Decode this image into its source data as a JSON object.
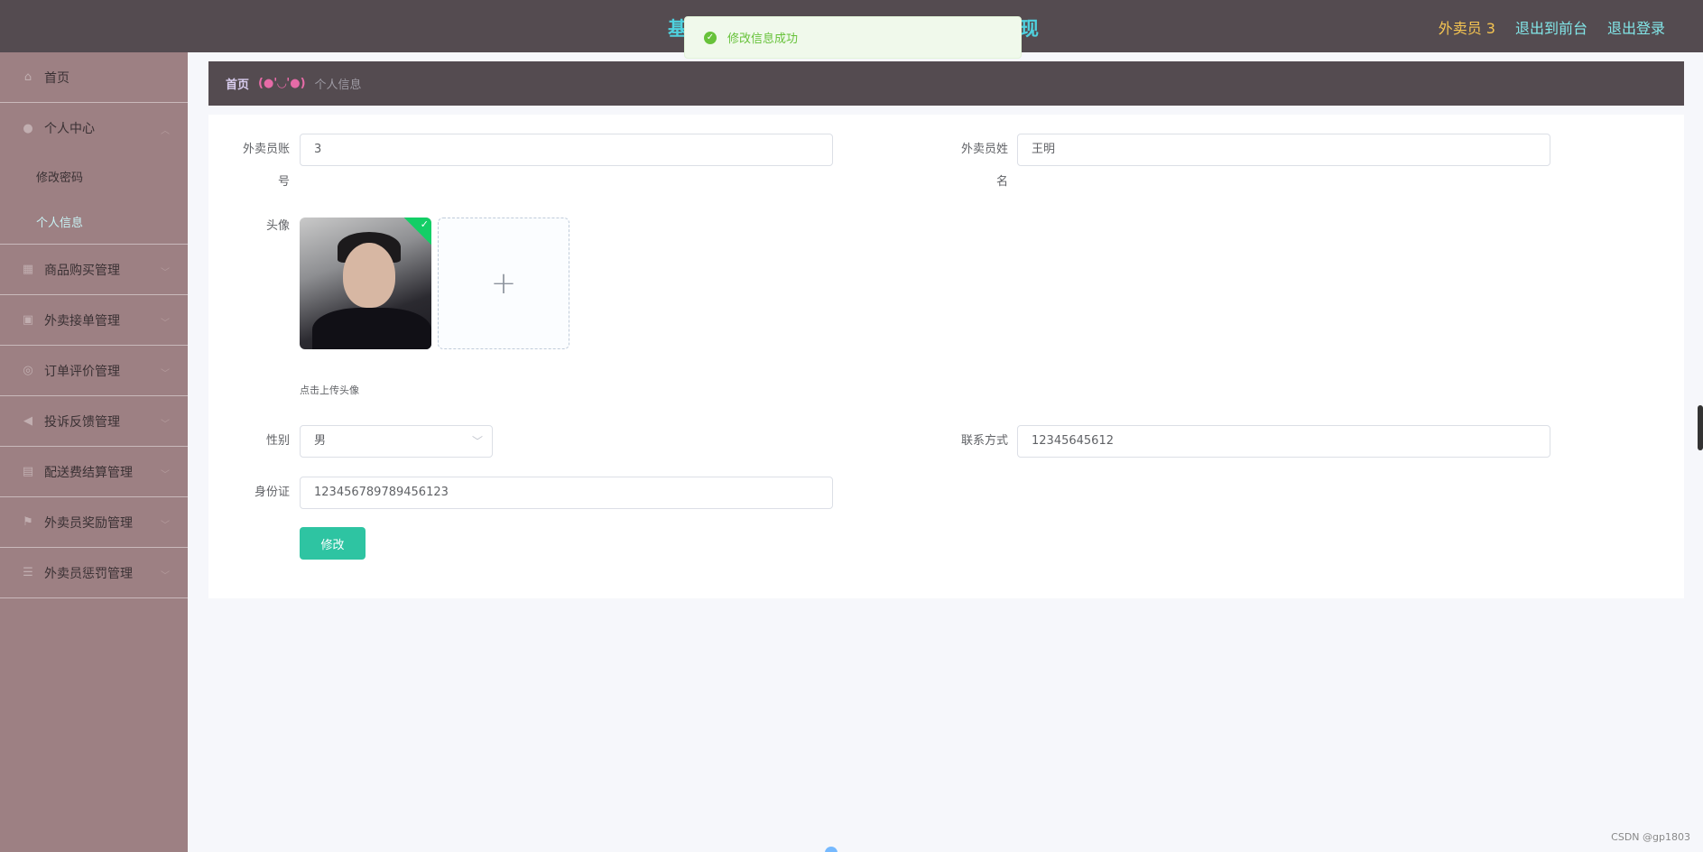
{
  "header": {
    "title_left": "基",
    "title_right": "现",
    "user": "外卖员 3",
    "back_front": "退出到前台",
    "logout": "退出登录"
  },
  "toast": {
    "message": "修改信息成功"
  },
  "sidebar": {
    "items": [
      {
        "label": "首页",
        "icon": "home-icon"
      },
      {
        "label": "个人中心",
        "icon": "user-icon",
        "children": [
          "修改密码",
          "个人信息"
        ]
      },
      {
        "label": "商品购买管理",
        "icon": "grid-icon"
      },
      {
        "label": "外卖接单管理",
        "icon": "apps-icon"
      },
      {
        "label": "订单评价管理",
        "icon": "circle-icon"
      },
      {
        "label": "投诉反馈管理",
        "icon": "megaphone-icon"
      },
      {
        "label": "配送费结算管理",
        "icon": "calculator-icon"
      },
      {
        "label": "外卖员奖励管理",
        "icon": "flag-icon"
      },
      {
        "label": "外卖员惩罚管理",
        "icon": "list-icon"
      }
    ]
  },
  "breadcrumb": {
    "home": "首页",
    "separator": "(●'◡'●)",
    "current": "个人信息"
  },
  "form": {
    "account_label_1": "外卖员账",
    "account_label_2": "号",
    "account_value": "3",
    "name_label_1": "外卖员姓",
    "name_label_2": "名",
    "name_value": "王明",
    "avatar_label": "头像",
    "upload_plus": "+",
    "upload_tip": "点击上传头像",
    "gender_label": "性别",
    "gender_value": "男",
    "phone_label": "联系方式",
    "phone_value": "12345645612",
    "id_label": "身份证",
    "id_value": "123456789789456123",
    "submit": "修改"
  },
  "watermark": "CSDN @gp1803",
  "colors": {
    "header_bg": "#544b50",
    "sidebar_bg": "#9d8083",
    "accent": "#2ec4a2",
    "success": "#67c23a"
  }
}
